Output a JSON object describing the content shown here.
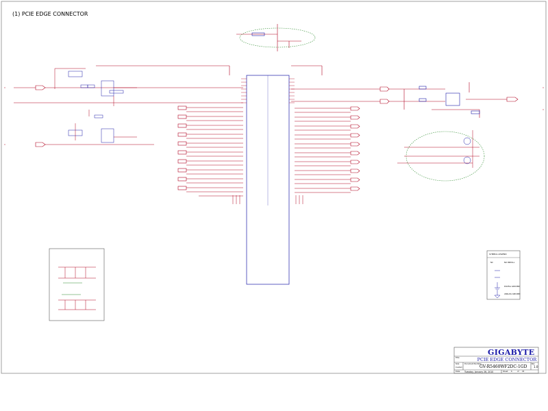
{
  "diagram": {
    "title": "(1) PCIE EDGE CONNECTOR"
  },
  "title_block": {
    "company": "GIGABYTE",
    "sheet_title": "PCIE EDGE CONNECTOR",
    "document_number": "GV-R5460WF2DC-1GD",
    "revision": "1.0",
    "label_title": "Title",
    "label_size": "Size",
    "label_doc": "Document Number",
    "label_rev": "Rev",
    "label_custom": "Custom",
    "label_date": "Date:",
    "label_sheet": "Sheet",
    "label_of": "of",
    "date": "Tuesday, January 26, 2010",
    "sheet": "6",
    "total_sheets": "29"
  },
  "legend": {
    "title": "SYMBOL LEGEND",
    "items": [
      {
        "symbol": "NC",
        "text": "NO INSTALL"
      },
      {
        "symbol": "",
        "text": "DIGITAL GROUND"
      },
      {
        "symbol": "",
        "text": "ANALOG GROUND"
      }
    ]
  },
  "colors": {
    "wire": "#b0001e",
    "component": "#1a1aa8",
    "note": "#2e8b2e",
    "border": "#555555"
  }
}
